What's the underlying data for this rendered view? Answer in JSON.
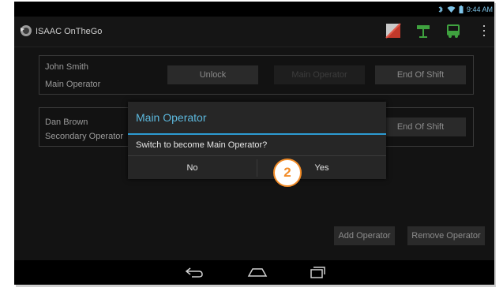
{
  "status_bar": {
    "time": "9:44 AM",
    "colors": {
      "icons": "#7ec4e8"
    }
  },
  "action_bar": {
    "app_title": "ISAAC OnTheGo",
    "actions": [
      {
        "icon": "flag-icon"
      },
      {
        "icon": "sign-icon"
      },
      {
        "icon": "bus-icon"
      },
      {
        "icon": "overflow-menu-icon"
      }
    ]
  },
  "operators": [
    {
      "name": "John Smith",
      "role": "Main Operator",
      "buttons": {
        "unlock": "Unlock",
        "main_operator": "Main Operator",
        "end_of_shift": "End Of Shift"
      }
    },
    {
      "name": "Dan Brown",
      "role": "Secondary Operator",
      "buttons": {
        "end_of_shift": "End Of Shift"
      }
    }
  ],
  "bottom_buttons": {
    "add_operator": "Add Operator",
    "remove_operator": "Remove Operator"
  },
  "dialog": {
    "title": "Main Operator",
    "message": "Switch to become Main Operator?",
    "no_label": "No",
    "yes_label": "Yes",
    "accent_color": "#2d9bd2"
  },
  "step_marker": {
    "number": "2",
    "color": "#f28c28"
  },
  "nav_bar": [
    {
      "icon": "back-icon"
    },
    {
      "icon": "home-icon"
    },
    {
      "icon": "recent-apps-icon"
    }
  ]
}
